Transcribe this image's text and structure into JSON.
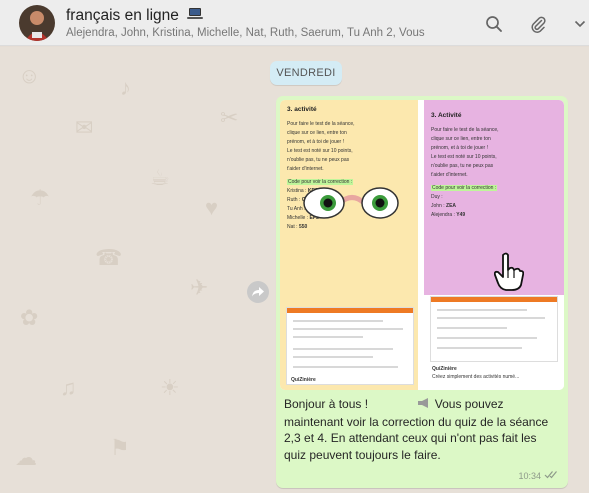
{
  "header": {
    "title": "français en ligne",
    "members": "Alejendra, John, Kristina, Michelle, Nat, Ruth, Saerum, Tu Anh 2, Vous"
  },
  "date_chip": "VENDREDI",
  "left_card": {
    "title": "3. activité",
    "lines": [
      "Pour faire le test de la séance,",
      "clique sur ce lien, entre ton",
      "prénom, et à toi de jouer !",
      "Le test est noté sur 10 points,",
      "n'oublie pas, tu ne peux pas",
      "t'aider d'internet."
    ],
    "code_label": "Code pour voir la correction :",
    "codes": [
      {
        "name": "Kristina :",
        "code": "KRD"
      },
      {
        "name": "Ruth :",
        "code": "OPR"
      },
      {
        "name": "Tu Anh :",
        "code": ""
      },
      {
        "name": "Michelle :",
        "code": "EP2"
      },
      {
        "name": "Nat :",
        "code": "550"
      }
    ],
    "caption": "QuiZinière"
  },
  "right_card": {
    "title": "3. Activité",
    "lines": [
      "Pour faire le test de la séance,",
      "clique sur ce lien, entre ton",
      "prénom, et à toi de jouer !",
      "Le test est noté sur 10 points,",
      "n'oublie pas, tu ne peux pas",
      "t'aider d'internet."
    ],
    "code_label": "Code pour voir la correction :",
    "codes": [
      {
        "name": "Duy :",
        "code": ""
      },
      {
        "name": "John :",
        "code": "ZEA"
      },
      {
        "name": "Alejendra :",
        "code": "Y49"
      }
    ],
    "caption": "QuiZinière",
    "caption_sub": "Créez simplement des activités numé..."
  },
  "message": {
    "line1_pre": "Bonjour à tous !",
    "line1_post": "Vous",
    "rest": "pouvez maintenant voir la correction du quiz de la séance 2,3 et 4. En attendant ceux qui n'ont pas fait les quiz peuvent toujours le faire.",
    "time": "10:34"
  },
  "icons": [
    "laptop-icon",
    "search-icon",
    "paperclip-icon",
    "chevron-down-icon",
    "forward-icon",
    "eyes-icon",
    "pointing-hand-icon",
    "double-check-icon"
  ],
  "colors": {
    "bubble": "#dcf8c6",
    "date_chip": "#d4ecf5",
    "left_card": "#fce8ae",
    "right_card": "#e7b3e1",
    "highlight": "#bff59a"
  }
}
